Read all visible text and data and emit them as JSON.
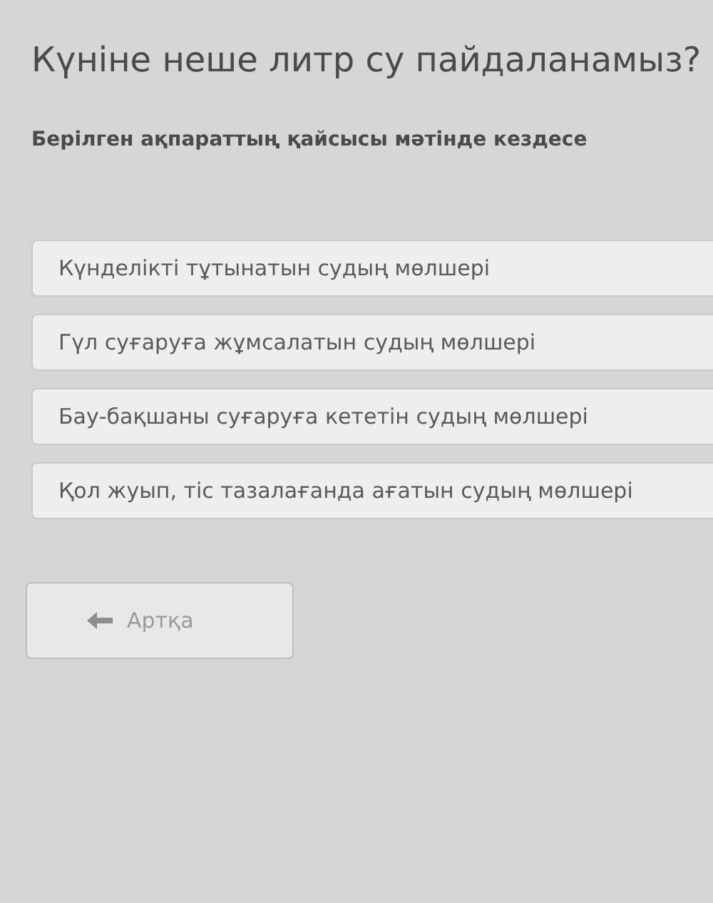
{
  "title": "Күніне неше литр су пайдаланамыз?",
  "question": "Берілген ақпараттың қайсысы мәтінде кездесе",
  "options": [
    {
      "label": "Күнделікті тұтынатын судың мөлшері"
    },
    {
      "label": "Гүл суғаруға жұмсалатын судың мөлшері"
    },
    {
      "label": "Бау-бақшаны суғаруға кететін судың мөлшері"
    },
    {
      "label": "Қол жуып, тіс тазалағанда ағатын судың мөлшері"
    }
  ],
  "back_button": {
    "label": "Артқа"
  }
}
